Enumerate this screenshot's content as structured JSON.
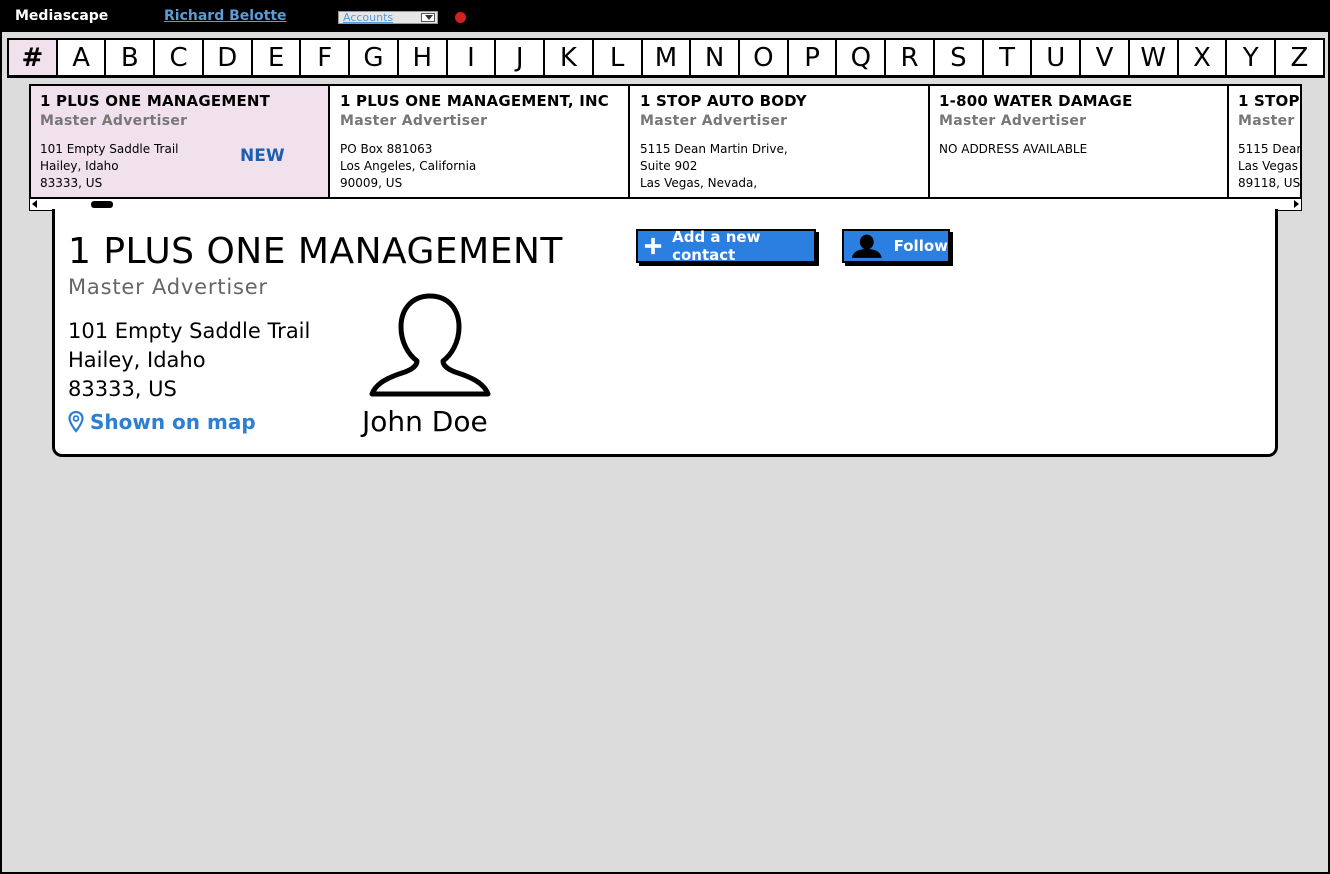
{
  "header": {
    "app_title": "Mediascape",
    "user_name": "Richard Belotte",
    "account_select": "Accounts"
  },
  "alphabet": [
    "#",
    "A",
    "B",
    "C",
    "D",
    "E",
    "F",
    "G",
    "H",
    "I",
    "J",
    "K",
    "L",
    "M",
    "N",
    "O",
    "P",
    "Q",
    "R",
    "S",
    "T",
    "U",
    "V",
    "W",
    "X",
    "Y",
    "Z"
  ],
  "alphabet_active": "#",
  "cards": [
    {
      "name": "1 PLUS ONE MANAGEMENT",
      "type": "Master Advertiser",
      "addr1": "101 Empty Saddle Trail",
      "addr2": "Hailey, Idaho",
      "addr3": "83333, US",
      "badge": "NEW"
    },
    {
      "name": "1 PLUS ONE MANAGEMENT, INC",
      "type": "Master Advertiser",
      "addr1": "PO Box 881063",
      "addr2": "Los Angeles, California",
      "addr3": "90009, US"
    },
    {
      "name": "1 STOP AUTO BODY",
      "type": "Master Advertiser",
      "addr1": "5115 Dean Martin Drive,",
      "addr2": "Suite 902",
      "addr3": "Las Vegas, Nevada,"
    },
    {
      "name": "1-800 WATER DAMAGE",
      "type": "Master Advertiser",
      "addr1": "NO ADDRESS AVAILABLE",
      "addr2": "",
      "addr3": ""
    },
    {
      "name": "1 STOP",
      "type": "Master",
      "addr1": "5115 Dean",
      "addr2": "Las Vegas",
      "addr3": "89118, US"
    }
  ],
  "detail": {
    "name": "1 PLUS ONE MANAGEMENT",
    "type": "Master Advertiser",
    "addr1": "101 Empty Saddle Trail",
    "addr2": "Hailey, Idaho",
    "addr3": "83333, US",
    "map_link": "Shown on map",
    "contact_name": "John Doe",
    "add_contact_label": "Add a new contact",
    "follow_label": "Follow"
  },
  "colors": {
    "accent_blue": "#2b7fe0",
    "selected_bg": "#f1e1ec",
    "record_red": "#d42020"
  }
}
